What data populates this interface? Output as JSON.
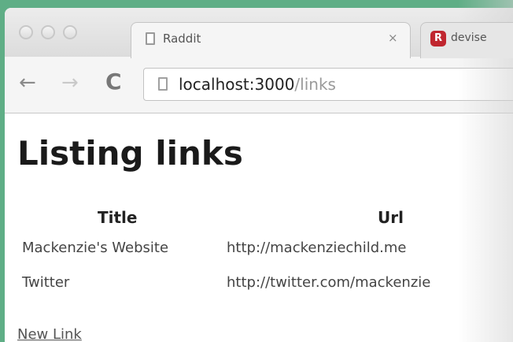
{
  "browser": {
    "tabs": [
      {
        "title": "Raddit",
        "close": "×",
        "icon": "document-icon",
        "active": true
      },
      {
        "title": "devise",
        "icon": "r-favicon",
        "icon_text": "R",
        "active": false
      }
    ],
    "toolbar": {
      "back": "←",
      "forward": "→",
      "reload": "C",
      "url_host": "localhost:3000",
      "url_path": "/links"
    }
  },
  "page": {
    "heading": "Listing links",
    "table": {
      "headers": [
        "Title",
        "Url"
      ],
      "rows": [
        [
          "Mackenzie's Website",
          "http://mackenziechild.me"
        ],
        [
          "Twitter",
          "http://twitter.com/mackenzie"
        ]
      ]
    },
    "new_link": "New Link"
  },
  "colors": {
    "background_green": "#5fae86",
    "favicon_red": "#c0262f"
  }
}
